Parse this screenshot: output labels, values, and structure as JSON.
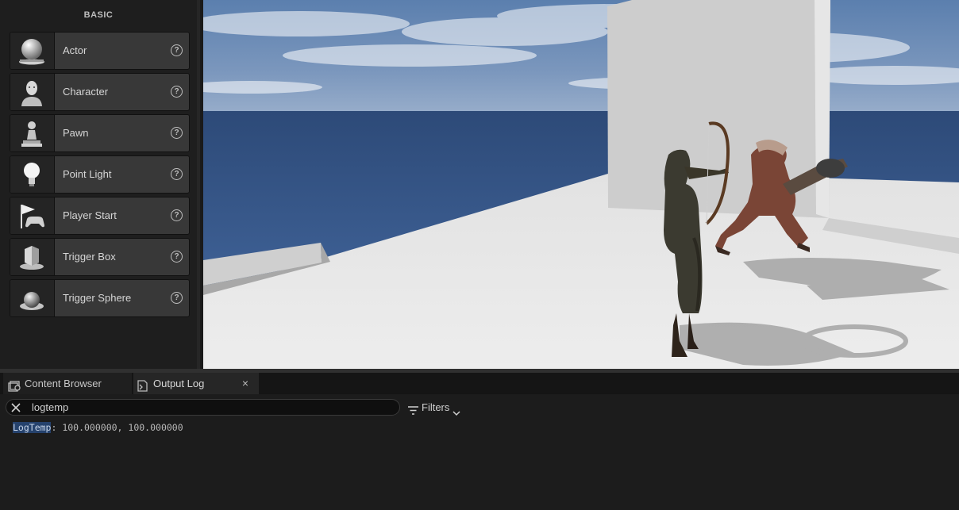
{
  "place_panel": {
    "section_title": "BASIC",
    "items": [
      {
        "label": "Actor",
        "icon": "actor-sphere-icon"
      },
      {
        "label": "Character",
        "icon": "character-bust-icon"
      },
      {
        "label": "Pawn",
        "icon": "pawn-icon"
      },
      {
        "label": "Point Light",
        "icon": "lightbulb-icon"
      },
      {
        "label": "Player Start",
        "icon": "player-start-flag-icon"
      },
      {
        "label": "Trigger Box",
        "icon": "trigger-box-icon"
      },
      {
        "label": "Trigger Sphere",
        "icon": "trigger-sphere-icon"
      }
    ],
    "help_glyph": "?"
  },
  "tabs": {
    "content_browser": "Content Browser",
    "output_log": "Output Log",
    "close_glyph": "×"
  },
  "output_log": {
    "search_value": "logtemp",
    "filters_label": "Filters",
    "entries": [
      {
        "category": "LogTemp",
        "message": ": 100.000000, 100.000000"
      }
    ]
  },
  "colors": {
    "panel_bg": "#1e1e1e",
    "item_bg": "#383838",
    "log_highlight": "#25426d",
    "sky": "#4a6b97"
  }
}
